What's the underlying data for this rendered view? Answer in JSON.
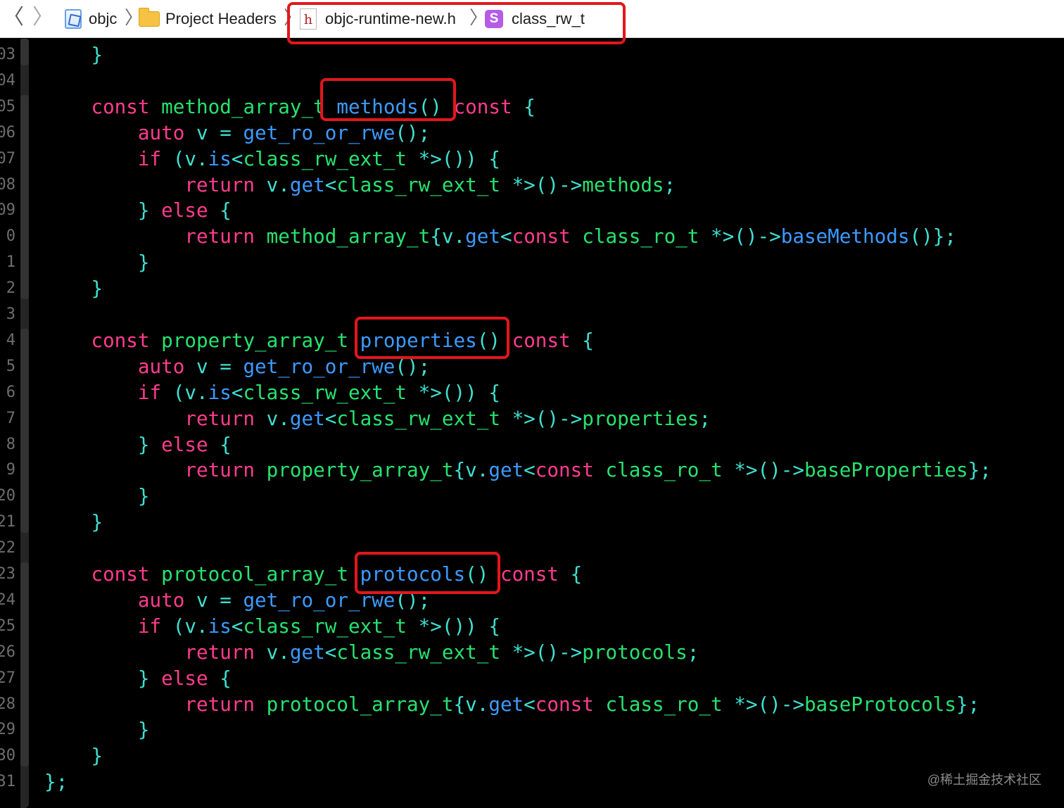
{
  "jumpbar": {
    "back_glyph": "〈",
    "forward_glyph": "〉",
    "separator": "〉",
    "crumbs": [
      {
        "label": "objc",
        "icon": "xcode-project-icon"
      },
      {
        "label": "Project Headers",
        "icon": "folder-icon"
      },
      {
        "label": "objc-runtime-new.h",
        "icon": "header-file-icon",
        "icon_glyph": "h"
      },
      {
        "label": "class_rw_t",
        "icon": "struct-icon",
        "icon_glyph": "S"
      }
    ]
  },
  "colors": {
    "keyword": "#ff3c8e",
    "type": "#27e36f",
    "function": "#3c9bff",
    "plain": "#3fe0d0",
    "annotation": "#e3161c",
    "background": "#000000"
  },
  "gutter": {
    "line_numbers": [
      "03",
      "04",
      "05",
      "06",
      "07",
      "08",
      "09",
      "0",
      "1",
      "2",
      "3",
      "4",
      "5",
      "6",
      "7",
      "8",
      "9",
      "20",
      "21",
      "22",
      "23",
      "24",
      "25",
      "26",
      "27",
      "28",
      "29",
      "30",
      "31"
    ]
  },
  "code_lines": [
    [
      {
        "c": "p",
        "t": "    }"
      }
    ],
    [],
    [
      {
        "c": "p",
        "t": "    "
      },
      {
        "c": "k",
        "t": "const"
      },
      {
        "c": "p",
        "t": " "
      },
      {
        "c": "t",
        "t": "method_array_t"
      },
      {
        "c": "p",
        "t": " "
      },
      {
        "c": "f",
        "t": "methods"
      },
      {
        "c": "p",
        "t": "() "
      },
      {
        "c": "k",
        "t": "const"
      },
      {
        "c": "p",
        "t": " {"
      }
    ],
    [
      {
        "c": "p",
        "t": "        "
      },
      {
        "c": "k",
        "t": "auto"
      },
      {
        "c": "p",
        "t": " v = "
      },
      {
        "c": "f",
        "t": "get_ro_or_rwe"
      },
      {
        "c": "p",
        "t": "();"
      }
    ],
    [
      {
        "c": "p",
        "t": "        "
      },
      {
        "c": "k",
        "t": "if"
      },
      {
        "c": "p",
        "t": " (v."
      },
      {
        "c": "f",
        "t": "is"
      },
      {
        "c": "p",
        "t": "<"
      },
      {
        "c": "t",
        "t": "class_rw_ext_t"
      },
      {
        "c": "p",
        "t": " *>()) {"
      }
    ],
    [
      {
        "c": "p",
        "t": "            "
      },
      {
        "c": "k",
        "t": "return"
      },
      {
        "c": "p",
        "t": " v."
      },
      {
        "c": "f",
        "t": "get"
      },
      {
        "c": "p",
        "t": "<"
      },
      {
        "c": "t",
        "t": "class_rw_ext_t"
      },
      {
        "c": "p",
        "t": " *>()->"
      },
      {
        "c": "t",
        "t": "methods"
      },
      {
        "c": "p",
        "t": ";"
      }
    ],
    [
      {
        "c": "p",
        "t": "        } "
      },
      {
        "c": "k",
        "t": "else"
      },
      {
        "c": "p",
        "t": " {"
      }
    ],
    [
      {
        "c": "p",
        "t": "            "
      },
      {
        "c": "k",
        "t": "return"
      },
      {
        "c": "p",
        "t": " "
      },
      {
        "c": "t",
        "t": "method_array_t"
      },
      {
        "c": "p",
        "t": "{v."
      },
      {
        "c": "f",
        "t": "get"
      },
      {
        "c": "p",
        "t": "<"
      },
      {
        "c": "k",
        "t": "const"
      },
      {
        "c": "p",
        "t": " "
      },
      {
        "c": "t",
        "t": "class_ro_t"
      },
      {
        "c": "p",
        "t": " *>()->"
      },
      {
        "c": "f",
        "t": "baseMethods"
      },
      {
        "c": "p",
        "t": "()};"
      }
    ],
    [
      {
        "c": "p",
        "t": "        }"
      }
    ],
    [
      {
        "c": "p",
        "t": "    }"
      }
    ],
    [],
    [
      {
        "c": "p",
        "t": "    "
      },
      {
        "c": "k",
        "t": "const"
      },
      {
        "c": "p",
        "t": " "
      },
      {
        "c": "t",
        "t": "property_array_t"
      },
      {
        "c": "p",
        "t": " "
      },
      {
        "c": "f",
        "t": "properties"
      },
      {
        "c": "p",
        "t": "() "
      },
      {
        "c": "k",
        "t": "const"
      },
      {
        "c": "p",
        "t": " {"
      }
    ],
    [
      {
        "c": "p",
        "t": "        "
      },
      {
        "c": "k",
        "t": "auto"
      },
      {
        "c": "p",
        "t": " v = "
      },
      {
        "c": "f",
        "t": "get_ro_or_rwe"
      },
      {
        "c": "p",
        "t": "();"
      }
    ],
    [
      {
        "c": "p",
        "t": "        "
      },
      {
        "c": "k",
        "t": "if"
      },
      {
        "c": "p",
        "t": " (v."
      },
      {
        "c": "f",
        "t": "is"
      },
      {
        "c": "p",
        "t": "<"
      },
      {
        "c": "t",
        "t": "class_rw_ext_t"
      },
      {
        "c": "p",
        "t": " *>()) {"
      }
    ],
    [
      {
        "c": "p",
        "t": "            "
      },
      {
        "c": "k",
        "t": "return"
      },
      {
        "c": "p",
        "t": " v."
      },
      {
        "c": "f",
        "t": "get"
      },
      {
        "c": "p",
        "t": "<"
      },
      {
        "c": "t",
        "t": "class_rw_ext_t"
      },
      {
        "c": "p",
        "t": " *>()->"
      },
      {
        "c": "t",
        "t": "properties"
      },
      {
        "c": "p",
        "t": ";"
      }
    ],
    [
      {
        "c": "p",
        "t": "        } "
      },
      {
        "c": "k",
        "t": "else"
      },
      {
        "c": "p",
        "t": " {"
      }
    ],
    [
      {
        "c": "p",
        "t": "            "
      },
      {
        "c": "k",
        "t": "return"
      },
      {
        "c": "p",
        "t": " "
      },
      {
        "c": "t",
        "t": "property_array_t"
      },
      {
        "c": "p",
        "t": "{v."
      },
      {
        "c": "f",
        "t": "get"
      },
      {
        "c": "p",
        "t": "<"
      },
      {
        "c": "k",
        "t": "const"
      },
      {
        "c": "p",
        "t": " "
      },
      {
        "c": "t",
        "t": "class_ro_t"
      },
      {
        "c": "p",
        "t": " *>()->"
      },
      {
        "c": "t",
        "t": "baseProperties"
      },
      {
        "c": "p",
        "t": "};"
      }
    ],
    [
      {
        "c": "p",
        "t": "        }"
      }
    ],
    [
      {
        "c": "p",
        "t": "    }"
      }
    ],
    [],
    [
      {
        "c": "p",
        "t": "    "
      },
      {
        "c": "k",
        "t": "const"
      },
      {
        "c": "p",
        "t": " "
      },
      {
        "c": "t",
        "t": "protocol_array_t"
      },
      {
        "c": "p",
        "t": " "
      },
      {
        "c": "f",
        "t": "protocols"
      },
      {
        "c": "p",
        "t": "() "
      },
      {
        "c": "k",
        "t": "const"
      },
      {
        "c": "p",
        "t": " {"
      }
    ],
    [
      {
        "c": "p",
        "t": "        "
      },
      {
        "c": "k",
        "t": "auto"
      },
      {
        "c": "p",
        "t": " v = "
      },
      {
        "c": "f",
        "t": "get_ro_or_rwe"
      },
      {
        "c": "p",
        "t": "();"
      }
    ],
    [
      {
        "c": "p",
        "t": "        "
      },
      {
        "c": "k",
        "t": "if"
      },
      {
        "c": "p",
        "t": " (v."
      },
      {
        "c": "f",
        "t": "is"
      },
      {
        "c": "p",
        "t": "<"
      },
      {
        "c": "t",
        "t": "class_rw_ext_t"
      },
      {
        "c": "p",
        "t": " *>()) {"
      }
    ],
    [
      {
        "c": "p",
        "t": "            "
      },
      {
        "c": "k",
        "t": "return"
      },
      {
        "c": "p",
        "t": " v."
      },
      {
        "c": "f",
        "t": "get"
      },
      {
        "c": "p",
        "t": "<"
      },
      {
        "c": "t",
        "t": "class_rw_ext_t"
      },
      {
        "c": "p",
        "t": " *>()->"
      },
      {
        "c": "t",
        "t": "protocols"
      },
      {
        "c": "p",
        "t": ";"
      }
    ],
    [
      {
        "c": "p",
        "t": "        } "
      },
      {
        "c": "k",
        "t": "else"
      },
      {
        "c": "p",
        "t": " {"
      }
    ],
    [
      {
        "c": "p",
        "t": "            "
      },
      {
        "c": "k",
        "t": "return"
      },
      {
        "c": "p",
        "t": " "
      },
      {
        "c": "t",
        "t": "protocol_array_t"
      },
      {
        "c": "p",
        "t": "{v."
      },
      {
        "c": "f",
        "t": "get"
      },
      {
        "c": "p",
        "t": "<"
      },
      {
        "c": "k",
        "t": "const"
      },
      {
        "c": "p",
        "t": " "
      },
      {
        "c": "t",
        "t": "class_ro_t"
      },
      {
        "c": "p",
        "t": " *>()->"
      },
      {
        "c": "t",
        "t": "baseProtocols"
      },
      {
        "c": "p",
        "t": "};"
      }
    ],
    [
      {
        "c": "p",
        "t": "        }"
      }
    ],
    [
      {
        "c": "p",
        "t": "    }"
      }
    ],
    [
      {
        "c": "p",
        "t": "};"
      }
    ]
  ],
  "watermark": "@稀土掘金技术社区"
}
